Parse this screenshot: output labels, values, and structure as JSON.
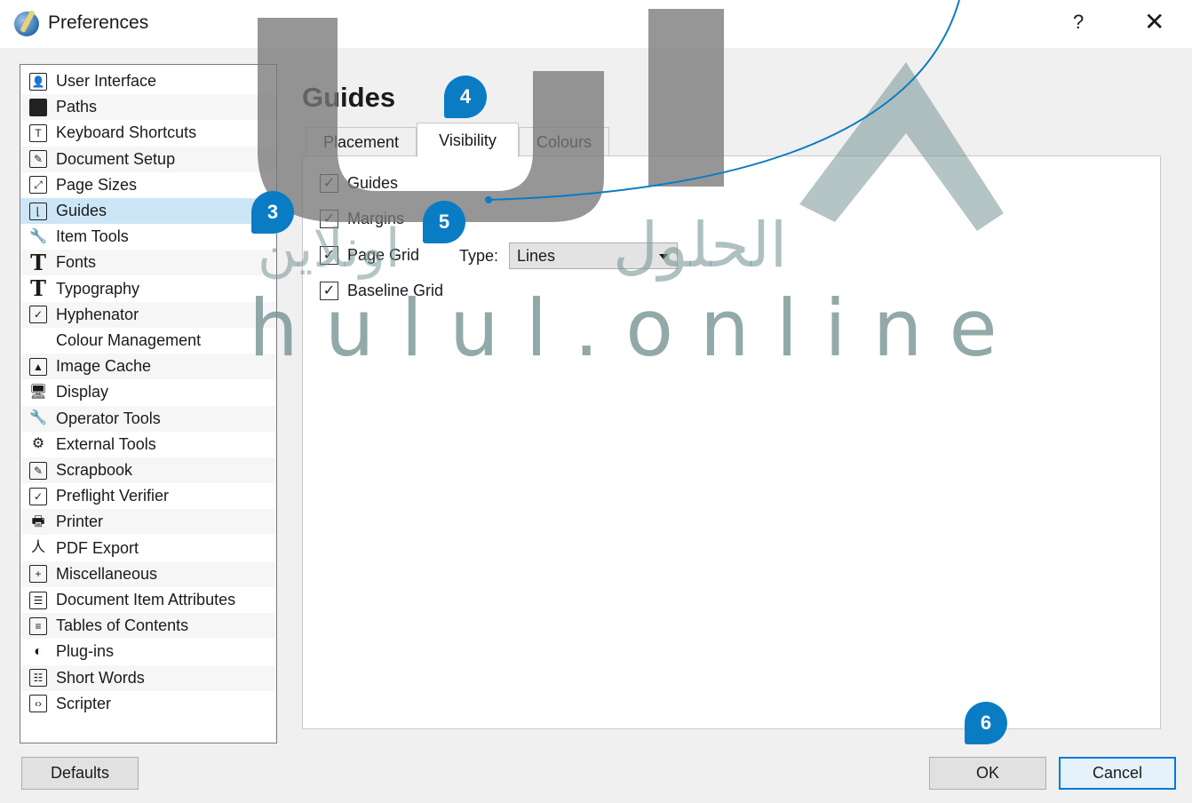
{
  "window": {
    "title": "Preferences",
    "help_label": "?",
    "close_label": "✕"
  },
  "sidebar": {
    "items": [
      {
        "label": "User Interface",
        "icon": "user-interface-icon"
      },
      {
        "label": "Paths",
        "icon": "folder-icon"
      },
      {
        "label": "Keyboard Shortcuts",
        "icon": "keyboard-icon"
      },
      {
        "label": "Document Setup",
        "icon": "document-setup-icon"
      },
      {
        "label": "Page Sizes",
        "icon": "page-sizes-icon"
      },
      {
        "label": "Guides",
        "icon": "guides-icon",
        "selected": true
      },
      {
        "label": "Item Tools",
        "icon": "wrench-icon"
      },
      {
        "label": "Fonts",
        "icon": "fonts-icon"
      },
      {
        "label": "Typography",
        "icon": "typography-icon"
      },
      {
        "label": "Hyphenator",
        "icon": "checkbox-icon"
      },
      {
        "label": "Colour Management",
        "icon": "colour-management-icon"
      },
      {
        "label": "Image Cache",
        "icon": "image-icon"
      },
      {
        "label": "Display",
        "icon": "monitor-icon"
      },
      {
        "label": "Operator Tools",
        "icon": "wrench-icon"
      },
      {
        "label": "External Tools",
        "icon": "gear-icon"
      },
      {
        "label": "Scrapbook",
        "icon": "scrapbook-icon"
      },
      {
        "label": "Preflight Verifier",
        "icon": "checkbox-icon"
      },
      {
        "label": "Printer",
        "icon": "printer-icon"
      },
      {
        "label": "PDF Export",
        "icon": "pdf-icon"
      },
      {
        "label": "Miscellaneous",
        "icon": "plus-icon"
      },
      {
        "label": "Document Item Attributes",
        "icon": "attributes-icon"
      },
      {
        "label": "Tables of Contents",
        "icon": "list-icon"
      },
      {
        "label": "Plug-ins",
        "icon": "plugin-icon"
      },
      {
        "label": "Short Words",
        "icon": "short-words-icon"
      },
      {
        "label": "Scripter",
        "icon": "code-icon"
      }
    ]
  },
  "main": {
    "heading": "Guides",
    "tabs": [
      {
        "label": "Placement",
        "active": false
      },
      {
        "label": "Visibility",
        "active": true
      },
      {
        "label": "Colours",
        "active": false
      }
    ],
    "options": {
      "guides": {
        "label": "Guides",
        "checked": true
      },
      "margins": {
        "label": "Margins",
        "checked": true
      },
      "page_grid": {
        "label": "Page Grid",
        "checked": true
      },
      "baseline_grid": {
        "label": "Baseline Grid",
        "checked": true
      }
    },
    "type_label": "Type:",
    "type_value": "Lines"
  },
  "buttons": {
    "defaults": "Defaults",
    "ok": "OK",
    "cancel": "Cancel"
  },
  "callouts": [
    "3",
    "4",
    "5",
    "6"
  ],
  "watermark": {
    "text": "hulul.online",
    "arabic": "الحلول",
    "arabic_2": "اونلاين"
  },
  "colors": {
    "selection": "#cde6f7",
    "accent": "#0078d7",
    "badge": "#0a7cc3"
  }
}
